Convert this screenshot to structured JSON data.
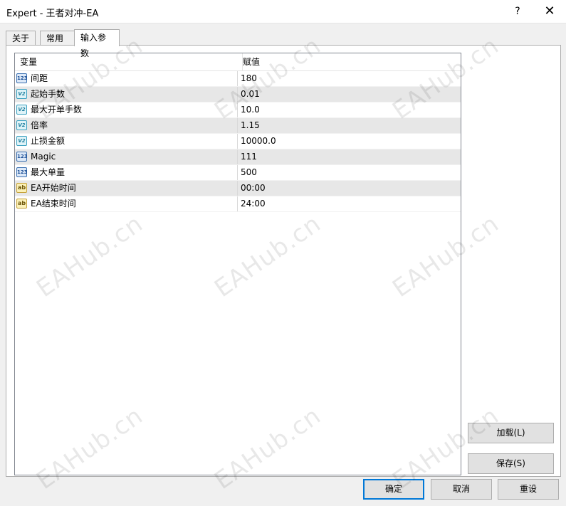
{
  "window": {
    "title": "Expert - 王者对冲-EA",
    "help_label": "?",
    "close_label": "✕"
  },
  "tabs": [
    {
      "label": "关于",
      "active": false
    },
    {
      "label": "常用",
      "active": false
    },
    {
      "label": "输入参数",
      "active": true
    }
  ],
  "grid": {
    "columns": [
      "变量",
      "赋值"
    ],
    "rows": [
      {
        "icon": "int-icon",
        "badge": "123",
        "name": "间距",
        "value": "180"
      },
      {
        "icon": "double-icon",
        "badge": "V2",
        "name": "起始手数",
        "value": "0.01"
      },
      {
        "icon": "double-icon",
        "badge": "V2",
        "name": "最大开单手数",
        "value": "10.0"
      },
      {
        "icon": "double-icon",
        "badge": "V2",
        "name": "倍率",
        "value": "1.15"
      },
      {
        "icon": "double-icon",
        "badge": "V2",
        "name": "止损金额",
        "value": "10000.0"
      },
      {
        "icon": "int-icon",
        "badge": "123",
        "name": "Magic",
        "value": "111"
      },
      {
        "icon": "int-icon",
        "badge": "123",
        "name": "最大单量",
        "value": "500"
      },
      {
        "icon": "string-icon",
        "badge": "ab",
        "name": "EA开始时间",
        "value": "00:00"
      },
      {
        "icon": "string-icon",
        "badge": "ab",
        "name": "EA结束时间",
        "value": "24:00"
      }
    ]
  },
  "side_buttons": {
    "load_label": "加载(L)",
    "save_label": "保存(S)"
  },
  "footer": {
    "ok_label": "确定",
    "cancel_label": "取消",
    "reset_label": "重设"
  },
  "watermark": "EAHub.cn"
}
